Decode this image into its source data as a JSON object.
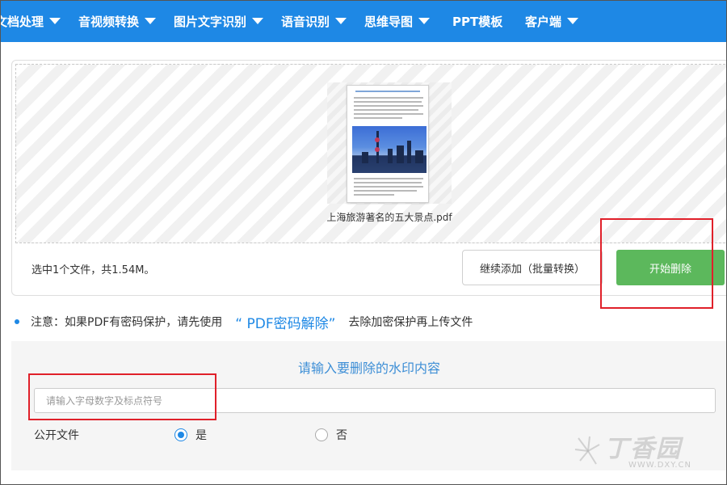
{
  "nav": {
    "items": [
      {
        "label": "文档处理",
        "has_caret": true
      },
      {
        "label": "音视频转换",
        "has_caret": true
      },
      {
        "label": "图片文字识别",
        "has_caret": true
      },
      {
        "label": "语音识别",
        "has_caret": true
      },
      {
        "label": "思维导图",
        "has_caret": true
      },
      {
        "label": "PPT模板",
        "has_caret": false
      },
      {
        "label": "客户端",
        "has_caret": true
      }
    ],
    "background_color": "#1e88e5"
  },
  "upload": {
    "file_name": "上海旅游著名的五大景点.pdf",
    "summary": "选中1个文件，共1.54M。",
    "add_more_label": "继续添加（批量转换）",
    "start_label": "开始删除",
    "start_color": "#5cb85c"
  },
  "notice": {
    "prefix": "注意：如果PDF有密码保护，请先使用",
    "link": "“ PDF密码解除”",
    "suffix": "去除加密保护再上传文件"
  },
  "watermark_form": {
    "title": "请输入要删除的水印内容",
    "input_value": "",
    "input_placeholder": "请输入字母数字及标点符号",
    "public_label": "公开文件",
    "options": [
      {
        "label": "是",
        "checked": true
      },
      {
        "label": "否",
        "checked": false
      }
    ]
  },
  "brand": {
    "name": "丁香园",
    "url": "WWW.DXY.CN"
  },
  "annotation_color": "#e0202a"
}
